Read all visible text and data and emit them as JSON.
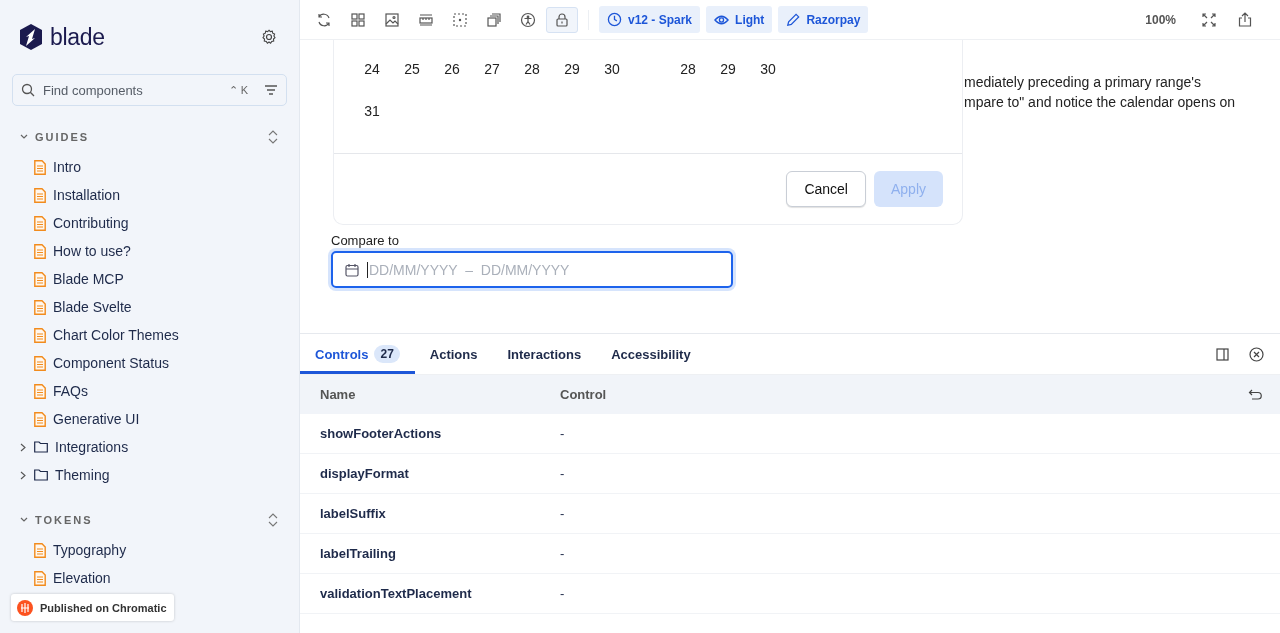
{
  "sidebar": {
    "brand": "blade",
    "search": {
      "placeholder": "Find components",
      "shortcut": "⌃ K"
    },
    "sections": [
      {
        "title": "GUIDES",
        "expanded": true,
        "items": [
          {
            "label": "Intro",
            "kind": "doc"
          },
          {
            "label": "Installation",
            "kind": "doc"
          },
          {
            "label": "Contributing",
            "kind": "doc"
          },
          {
            "label": "How to use?",
            "kind": "doc"
          },
          {
            "label": "Blade MCP",
            "kind": "doc"
          },
          {
            "label": "Blade Svelte",
            "kind": "doc"
          },
          {
            "label": "Chart Color Themes",
            "kind": "doc"
          },
          {
            "label": "Component Status",
            "kind": "doc"
          },
          {
            "label": "FAQs",
            "kind": "doc"
          },
          {
            "label": "Generative UI",
            "kind": "doc"
          },
          {
            "label": "Integrations",
            "kind": "folder",
            "expanded": false
          },
          {
            "label": "Theming",
            "kind": "folder",
            "expanded": false
          }
        ]
      },
      {
        "title": "TOKENS",
        "expanded": true,
        "items": [
          {
            "label": "Typography",
            "kind": "doc"
          },
          {
            "label": "Elevation",
            "kind": "doc"
          }
        ]
      }
    ],
    "chromatic_badge": "Published on Chromatic"
  },
  "toolbar": {
    "tools": [
      {
        "kind": "refresh",
        "selected": false
      },
      {
        "kind": "grid",
        "selected": false
      },
      {
        "kind": "image",
        "selected": false
      },
      {
        "kind": "ruler",
        "selected": false
      },
      {
        "kind": "outline",
        "selected": false
      },
      {
        "kind": "layers",
        "selected": false
      },
      {
        "kind": "accessibility",
        "selected": false
      },
      {
        "kind": "lock",
        "selected": true
      }
    ],
    "pills": [
      {
        "kind": "version",
        "label": "v12 - Spark"
      },
      {
        "kind": "theme",
        "label": "Light"
      },
      {
        "kind": "brand",
        "label": "Razorpay"
      }
    ],
    "zoom": "100%"
  },
  "canvas": {
    "description_lines": [
      "mediately preceding a primary range's",
      "mpare to\" and notice the calendar opens on"
    ],
    "calendar": {
      "left_weeks": [
        [
          "24",
          "25",
          "26",
          "27",
          "28",
          "29",
          "30"
        ],
        [
          "31"
        ]
      ],
      "right_weeks": [
        [
          "28",
          "29",
          "30"
        ]
      ],
      "buttons": [
        {
          "label": "Cancel",
          "disabled": false,
          "kind": "secondary"
        },
        {
          "label": "Apply",
          "disabled": true,
          "kind": "primary"
        }
      ]
    },
    "compare_field": {
      "label": "Compare to",
      "placeholder": "DD/MM/YYYY  –  DD/MM/YYYY",
      "focused": true
    }
  },
  "panel": {
    "tabs": [
      {
        "label": "Controls",
        "badge": "27",
        "selected": true
      },
      {
        "label": "Actions",
        "selected": false
      },
      {
        "label": "Interactions",
        "selected": false
      },
      {
        "label": "Accessibility",
        "selected": false
      }
    ],
    "table": {
      "columns": [
        "Name",
        "Control"
      ],
      "rows": [
        {
          "name": "showFooterActions",
          "control": "-"
        },
        {
          "name": "displayFormat",
          "control": "-"
        },
        {
          "name": "labelSuffix",
          "control": "-"
        },
        {
          "name": "labelTrailing",
          "control": "-"
        },
        {
          "name": "validationTextPlacement",
          "control": "-"
        }
      ]
    }
  }
}
